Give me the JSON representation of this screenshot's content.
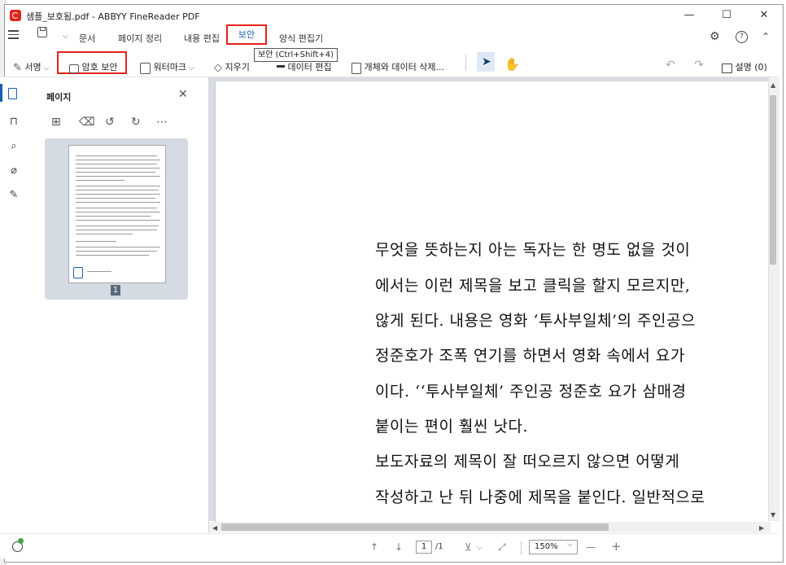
{
  "window": {
    "title": "샘플_보호됨.pdf - ABBYY FineReader PDF",
    "minimize": "—",
    "maximize": "☐",
    "close": "✕"
  },
  "menu": {
    "items": [
      "문서",
      "페이지 정리",
      "내용 편집",
      "보안",
      "양식 편집기"
    ],
    "active": "보안",
    "tooltip": "보안 (Ctrl+Shift+4)"
  },
  "toolbar": {
    "signature": "서명",
    "password": "암호 보안",
    "watermark": "워터마크",
    "erase": "지우기",
    "redact": "데이터 편집",
    "remove_objects": "개체와 데이터 삭제...",
    "comments": "설명 (0)"
  },
  "panel": {
    "title": "페이지",
    "thumb_page_number": "1"
  },
  "document": {
    "lines": [
      "무엇을 뜻하는지 아는 독자는 한 명도 없을 것이",
      "에서는 이런 제목을 보고 클릭을 할지 모르지만,",
      "않게 된다. 내용은 영화 ‘투사부일체’의 주인공으",
      "정준호가 조폭 연기를 하면서 영화 속에서 요가 ",
      "이다. ‘‘투사부일체’ 주인공 정준호 요가 삼매경",
      "붙이는 편이 훨씬 낫다.",
      "  보도자료의 제목이 잘 떠오르지 않으면 어떻게",
      "작성하고 난 뒤 나중에 제목을 붙인다. 일반적으로"
    ]
  },
  "status": {
    "current_page": "1",
    "total_pages": "/1",
    "zoom": "150%",
    "zoom_out": "—",
    "zoom_in": "+"
  },
  "colors": {
    "accent": "#1a5fb4",
    "highlight_box": "#e2231a"
  }
}
